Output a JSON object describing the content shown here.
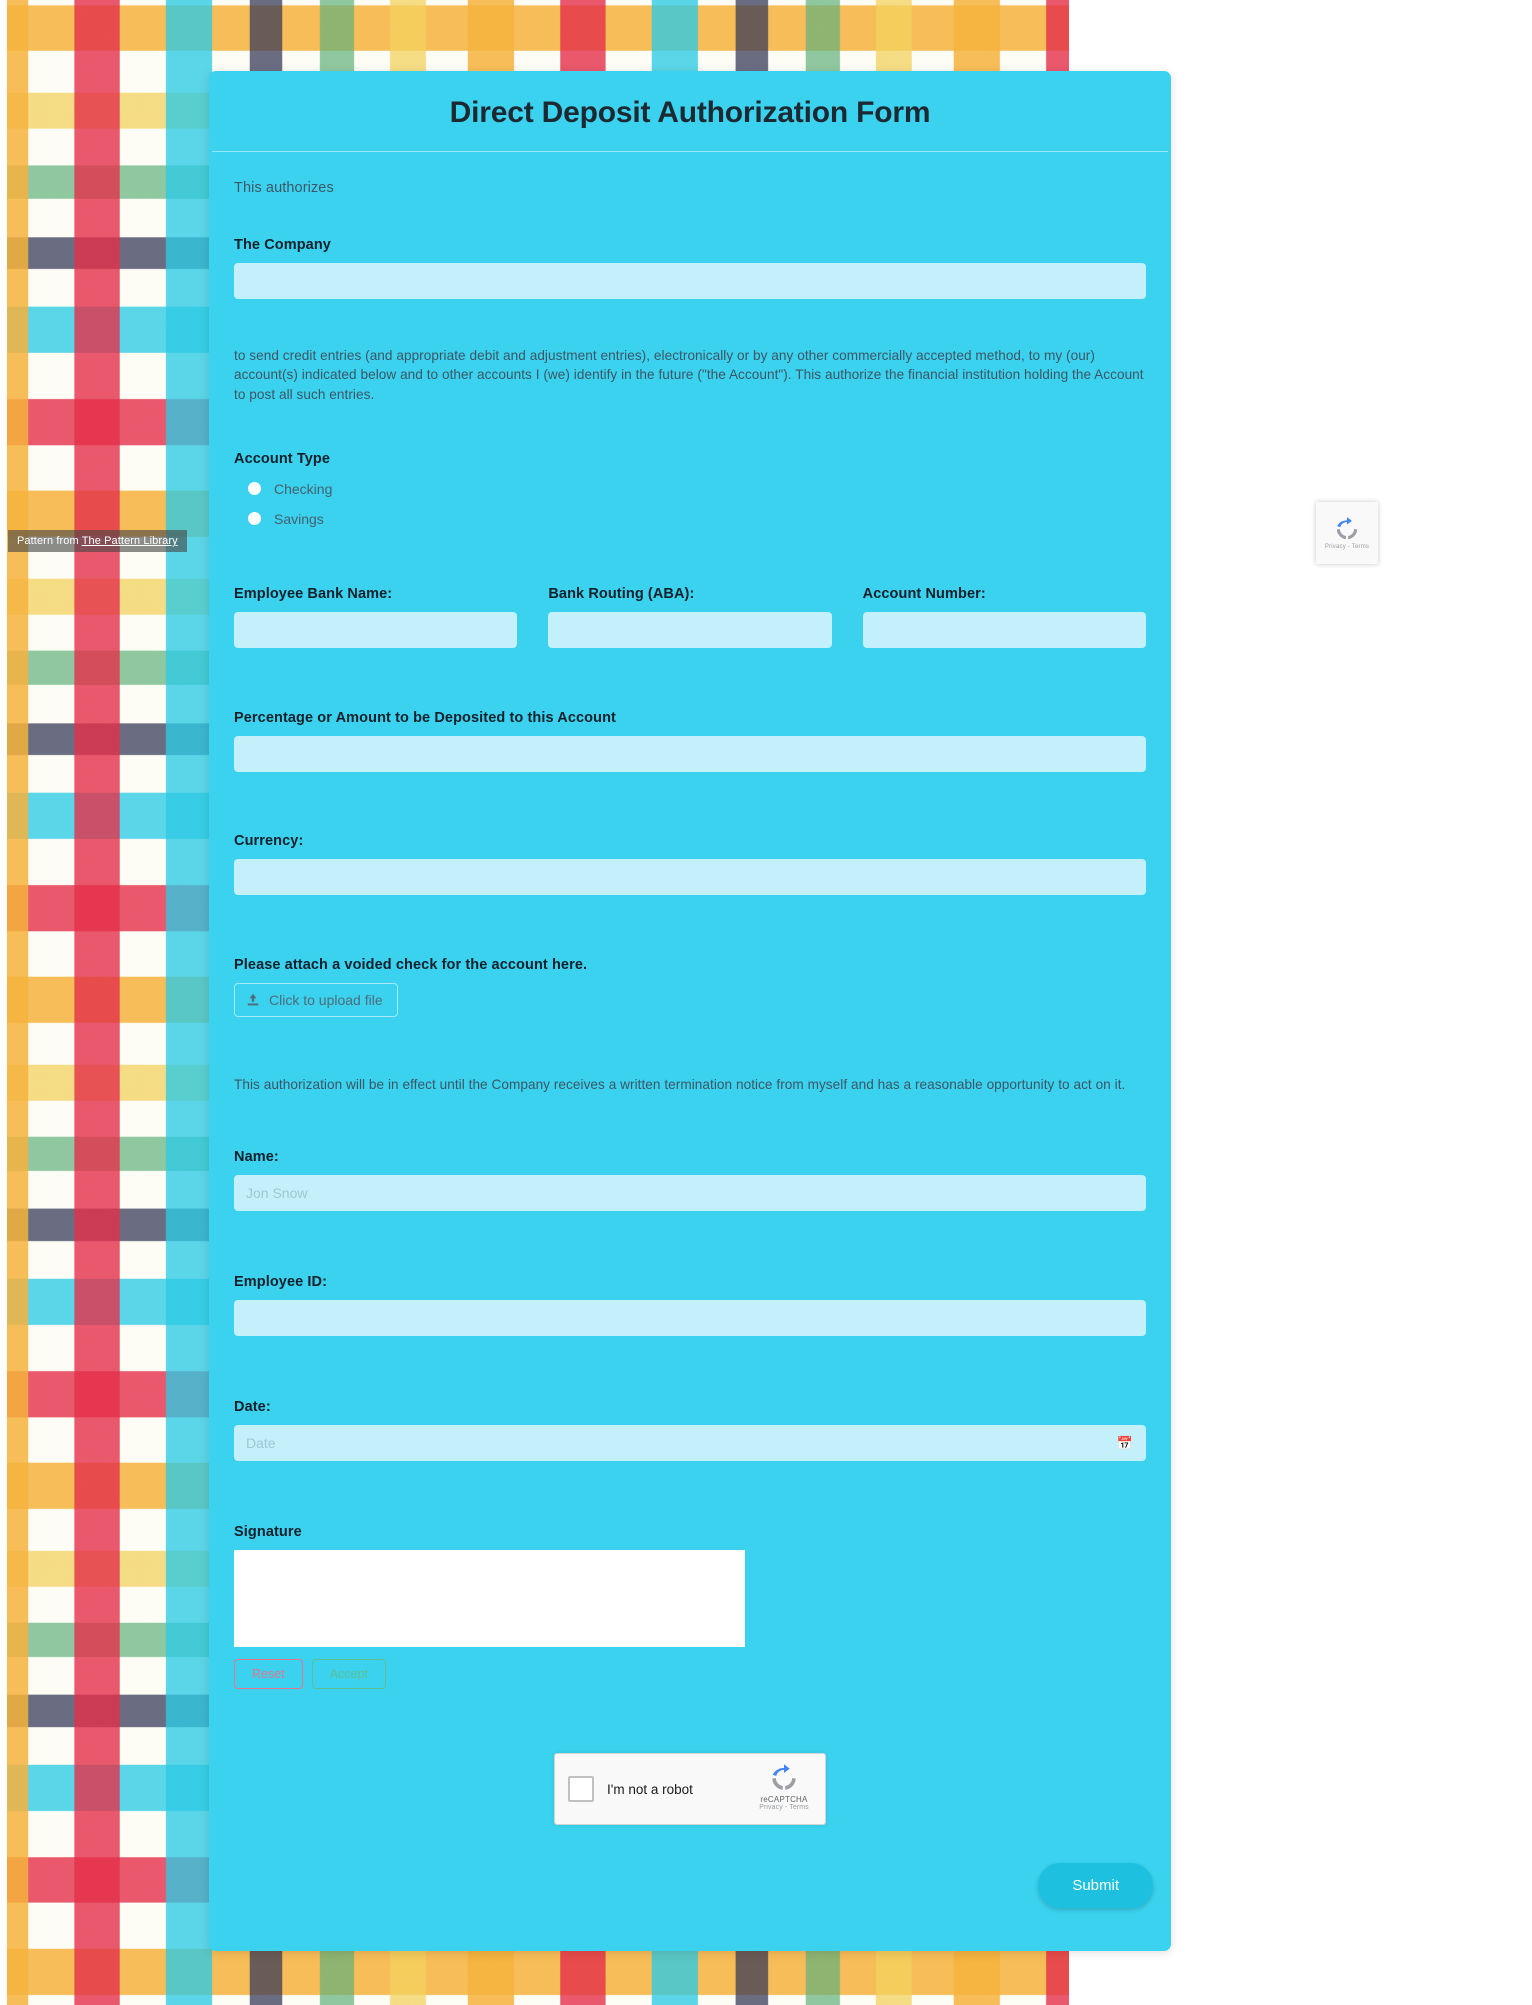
{
  "background": {
    "attribution_prefix": "Pattern from ",
    "attribution_link": "The Pattern Library",
    "accent_color": "#3ad2ee",
    "input_color": "#c3f0fa"
  },
  "floating_badge": {
    "icon": "recaptcha-icon",
    "privacy_terms": "Privacy - Terms"
  },
  "form": {
    "title": "Direct Deposit Authorization Form",
    "lead_text": "This authorizes",
    "company": {
      "label": "The Company",
      "value": "",
      "placeholder": ""
    },
    "consent_paragraph": "to send credit entries (and appropriate debit and adjustment entries), electronically or by any other commercially accepted method, to my (our) account(s) indicated below and to other accounts I (we) identify in the future (\"the Account\"). This authorize the financial institution holding the Account to post all such entries.",
    "account_type": {
      "label": "Account Type",
      "options": [
        {
          "label": "Checking",
          "selected": false
        },
        {
          "label": "Savings",
          "selected": false
        }
      ]
    },
    "bank_fields": [
      {
        "label": "Employee Bank Name:",
        "value": ""
      },
      {
        "label": "Bank Routing (ABA):",
        "value": ""
      },
      {
        "label": "Account Number:",
        "value": ""
      }
    ],
    "percentage": {
      "label": "Percentage or Amount to be Deposited to this Account",
      "value": ""
    },
    "currency": {
      "label": "Currency:",
      "value": ""
    },
    "voided_check": {
      "label": "Please attach a voided check for the account here.",
      "upload_button": "Click to upload file",
      "upload_icon": "upload-icon"
    },
    "termination_paragraph": "This authorization will be in effect until the Company receives a written termination notice from myself and has a reasonable opportunity to act on it.",
    "name": {
      "label": "Name:",
      "value": "",
      "placeholder": "Jon Snow"
    },
    "employee_id": {
      "label": "Employee ID:",
      "value": ""
    },
    "date": {
      "label": "Date:",
      "value": "",
      "placeholder": "Date",
      "icon": "calendar-icon"
    },
    "signature": {
      "label": "Signature",
      "reset_button": "Reset",
      "accept_button": "Accept",
      "reset_color": "#e8758e",
      "accept_color": "#5fbf93"
    },
    "captcha": {
      "checkbox_label": "I'm not a robot",
      "brand_name": "reCAPTCHA",
      "privacy_terms": "Privacy - Terms",
      "icon": "recaptcha-icon"
    },
    "submit_button": "Submit"
  }
}
